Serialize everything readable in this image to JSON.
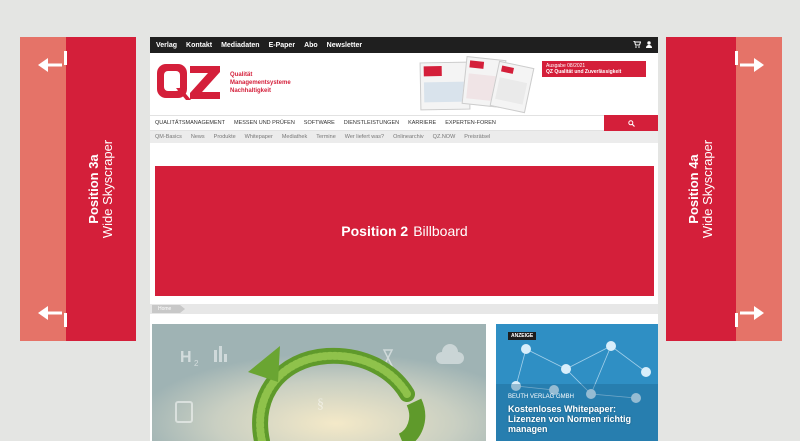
{
  "colors": {
    "brand_red": "#d41f3a",
    "pale_red": "#e57368",
    "background": "#e4e5e3",
    "topbar": "#1f1f1f"
  },
  "left_skyscraper": {
    "position": "Position 3a",
    "kind": "Wide Skyscraper"
  },
  "right_skyscraper": {
    "position": "Position 4a",
    "kind": "Wide Skyscraper"
  },
  "topbar": {
    "links": [
      "Verlag",
      "Kontakt",
      "Mediadaten",
      "E-Paper",
      "Abo",
      "Newsletter"
    ],
    "icons": [
      "cart-icon",
      "user-icon"
    ]
  },
  "header": {
    "logo_text": "QZ",
    "tagline": [
      "Qualität",
      "Managementsysteme",
      "Nachhaltigkeit"
    ],
    "issue_line1": "Ausgabe 08/2021",
    "issue_line2": "QZ Qualität und Zuverlässigkeit"
  },
  "main_nav": [
    "QUALITÄTSMANAGEMENT",
    "MESSEN UND PRÜFEN",
    "SOFTWARE",
    "DIENSTLEISTUNGEN",
    "KARRIERE",
    "EXPERTEN-FOREN"
  ],
  "sub_nav": [
    "QM-Basics",
    "News",
    "Produkte",
    "Whitepaper",
    "Mediathek",
    "Termine",
    "Wer liefert was?",
    "Onlinearchiv",
    "QZ.NOW",
    "Preisrätsel"
  ],
  "billboard": {
    "position": "Position 2",
    "kind": "Billboard"
  },
  "breadcrumb": {
    "home": "Home"
  },
  "ad_teaser": {
    "badge": "ANZEIGE",
    "publisher": "BEUTH VERLAG GMBH",
    "title": "Kostenloses Whitepaper: Lizenzen von Normen richtig managen"
  }
}
